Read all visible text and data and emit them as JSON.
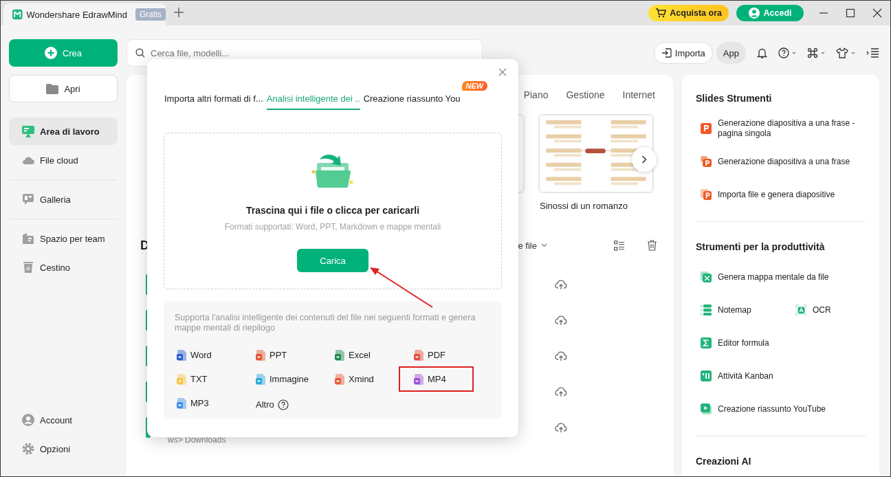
{
  "app_tab": {
    "title": "Wondershare EdrawMind",
    "badge": "Gratis"
  },
  "header": {
    "buy_button": "Acquista ora",
    "login_button": "Accedi"
  },
  "sidebar": {
    "create_button": "Crea",
    "open_button": "Apri",
    "groups": [
      {
        "items": [
          {
            "label": "Area di lavoro",
            "kind": "workspace",
            "selected": true
          },
          {
            "label": "File cloud",
            "kind": "cloud",
            "selected": false
          }
        ]
      },
      {
        "items": [
          {
            "label": "Galleria",
            "kind": "gallery",
            "selected": false
          }
        ]
      },
      {
        "items": [
          {
            "label": "Spazio per team",
            "kind": "team",
            "selected": false
          },
          {
            "label": "Cestino",
            "kind": "trash",
            "selected": false
          }
        ]
      }
    ],
    "bottom_items": [
      {
        "label": "Account",
        "kind": "account"
      },
      {
        "label": "Opzioni",
        "kind": "settings"
      }
    ]
  },
  "search": {
    "placeholder": "Cerca file, modelli..."
  },
  "toolbar": {
    "import_button": "Importa",
    "app_button": "App"
  },
  "main": {
    "tabs": [
      {
        "label": "Piano",
        "selected": false
      },
      {
        "label": "Gestione",
        "selected": false
      },
      {
        "label": "Internet",
        "selected": false
      }
    ],
    "template": {
      "title": "Sinossi di un romanzo"
    },
    "section_heading": "D",
    "sort_label": "e file",
    "files": [
      {
        "kind": "file"
      },
      {
        "kind": "file"
      },
      {
        "kind": "file"
      },
      {
        "kind": "file"
      },
      {
        "kind": "file",
        "location": "ws> Downloads"
      }
    ]
  },
  "dialog": {
    "tabs": [
      {
        "label": "Importa altri formati di f...",
        "selected": false
      },
      {
        "label": "Analisi intelligente dei ..",
        "selected": true
      },
      {
        "label": "Creazione riassunto You",
        "selected": false,
        "badge": "NEW"
      }
    ],
    "drop_title": "Trascina qui i file o clicca per caricarli",
    "drop_hint": "Formati supportati: Word, PPT, Markdown e mappe mentali",
    "upload_button": "Carica",
    "formats_note": "Supporta l'analisi intelligente dei contenuti del file nei seguenti formati e genera mappe mentali di riepilogo",
    "formats": [
      {
        "label": "Word",
        "kind": "word",
        "highlighted": false
      },
      {
        "label": "PPT",
        "kind": "ppt",
        "highlighted": false
      },
      {
        "label": "Excel",
        "kind": "excel",
        "highlighted": false
      },
      {
        "label": "PDF",
        "kind": "pdf",
        "highlighted": false
      },
      {
        "label": "TXT",
        "kind": "txt",
        "highlighted": false
      },
      {
        "label": "Immagine",
        "kind": "image",
        "highlighted": false
      },
      {
        "label": "Xmind",
        "kind": "xmind",
        "highlighted": false
      },
      {
        "label": "MP4",
        "kind": "mp4",
        "highlighted": true
      },
      {
        "label": "MP3",
        "kind": "mp3",
        "highlighted": false
      }
    ],
    "more_link": "Altro"
  },
  "tools_panel": {
    "sections": [
      {
        "title": "Slides Strumenti",
        "rows": [
          {
            "items": [
              {
                "label": "Generazione diapositiva a una frase - pagina singola",
                "kind": "slide"
              }
            ]
          },
          {
            "items": [
              {
                "label": "Generazione diapositiva a una frase",
                "kind": "slide_text"
              }
            ]
          },
          {
            "items": [
              {
                "label": "Importa file e genera diapositive",
                "kind": "slide_import"
              }
            ]
          }
        ]
      },
      {
        "title": "Strumenti per la produttività",
        "rows": [
          {
            "items": [
              {
                "label": "Genera mappa mentale da file",
                "kind": "mindmap"
              }
            ]
          },
          {
            "items": [
              {
                "label": "Notemap",
                "kind": "notemap"
              },
              {
                "label": "OCR",
                "kind": "ocr"
              }
            ]
          },
          {
            "items": [
              {
                "label": "Editor formula",
                "kind": "formula"
              }
            ]
          },
          {
            "items": [
              {
                "label": "Attività Kanban",
                "kind": "kanban"
              }
            ]
          },
          {
            "items": [
              {
                "label": "Creazione riassunto YouTube",
                "kind": "youtube"
              }
            ]
          }
        ]
      },
      {
        "title": "Creazioni AI"
      }
    ]
  }
}
